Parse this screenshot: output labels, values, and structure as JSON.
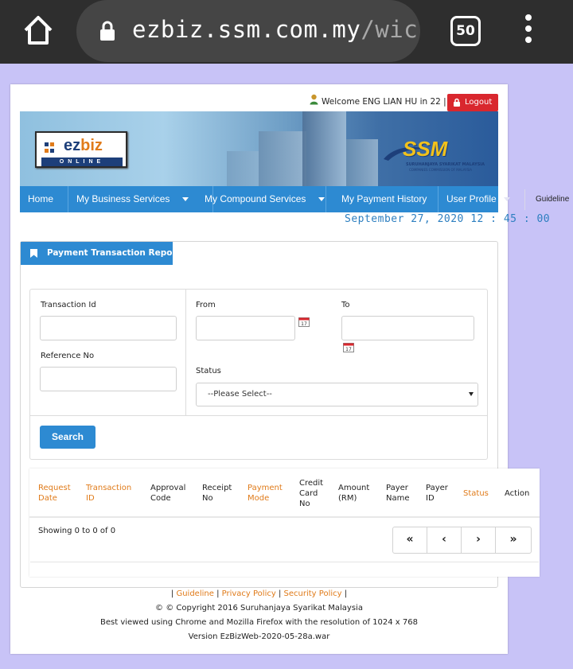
{
  "browser": {
    "url_host": "ezbiz.ssm.com.my",
    "url_path": "/wick",
    "tab_count": "50"
  },
  "header": {
    "welcome": "Welcome ENG LIAN HU in 22 |",
    "logout_label": "Logout"
  },
  "banner": {
    "logo_ez": "ez",
    "logo_biz": "biz",
    "logo_online": "ONLINE",
    "ssm_logo": "SSM",
    "ssm_caption_1": "SURUHANJAYA SYARIKAT MALAYSIA",
    "ssm_caption_2": "COMPANIES COMMISSION OF MALAYSIA"
  },
  "nav": {
    "items": [
      {
        "label": "Home"
      },
      {
        "label": "My Business Services"
      },
      {
        "label": "My Compound Services"
      },
      {
        "label": "My Payment History"
      },
      {
        "label": "User Profile"
      },
      {
        "label": "Guideline"
      }
    ]
  },
  "datetime": "September 27, 2020 12 : 45 : 00",
  "report": {
    "title": "Payment Transaction Report",
    "transaction_id_label": "Transaction Id",
    "reference_no_label": "Reference No",
    "from_label": "From",
    "to_label": "To",
    "status_label": "Status",
    "status_value": "--Please Select--",
    "search_label": "Search"
  },
  "table": {
    "columns": [
      {
        "l1": "Request",
        "l2": "Date",
        "l3": ""
      },
      {
        "l1": "Transaction",
        "l2": "ID",
        "l3": ""
      },
      {
        "l1": "Approval",
        "l2": "Code",
        "l3": ""
      },
      {
        "l1": "Receipt",
        "l2": "No",
        "l3": ""
      },
      {
        "l1": "Payment",
        "l2": "Mode",
        "l3": ""
      },
      {
        "l1": "Credit",
        "l2": "Card",
        "l3": "No"
      },
      {
        "l1": "Amount",
        "l2": "(RM)",
        "l3": ""
      },
      {
        "l1": "Payer",
        "l2": "Name",
        "l3": ""
      },
      {
        "l1": "Payer",
        "l2": "ID",
        "l3": ""
      },
      {
        "l1": "Status",
        "l2": "",
        "l3": ""
      },
      {
        "l1": "Action",
        "l2": "",
        "l3": ""
      }
    ],
    "showing": "Showing 0 to 0 of 0",
    "pager": {
      "first": "«",
      "prev": "‹",
      "next": "›",
      "last": "»"
    }
  },
  "footer": {
    "sep_open": "|",
    "guideline": "Guideline",
    "privacy": "Privacy Policy",
    "security": "Security Policy",
    "copyright": "© © Copyright 2016 Suruhanjaya Syarikat Malaysia",
    "best_viewed": "Best viewed using Chrome and Mozilla Firefox with the resolution of 1024 x 768",
    "version": "Version EzBizWeb-2020-05-28a.war"
  },
  "colors": {
    "accent_blue": "#2d8ad2",
    "link_orange": "#e07b1a",
    "logout_red": "#d9272e",
    "page_bg": "#c8c3f7"
  }
}
